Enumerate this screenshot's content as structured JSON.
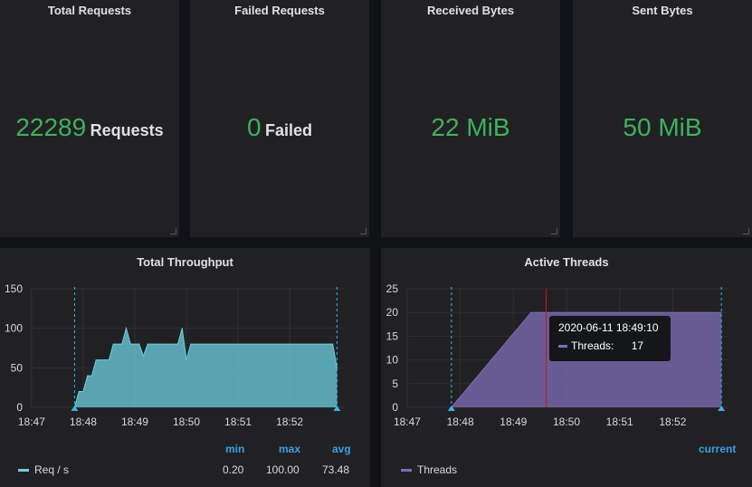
{
  "stats": [
    {
      "title": "Total Requests",
      "value": "22289",
      "unit": "Requests"
    },
    {
      "title": "Failed Requests",
      "value": "0",
      "unit": "Failed"
    },
    {
      "title": "Received Bytes",
      "value": "22 MiB",
      "unit": ""
    },
    {
      "title": "Sent Bytes",
      "value": "50 MiB",
      "unit": ""
    }
  ],
  "throughput": {
    "title": "Total Throughput",
    "legend": {
      "series": "Req / s",
      "min_label": "min",
      "max_label": "max",
      "avg_label": "avg",
      "min": "0.20",
      "max": "100.00",
      "avg": "73.48"
    },
    "color": "#6ed0e0"
  },
  "threads": {
    "title": "Active Threads",
    "legend": {
      "series": "Threads",
      "current_label": "current"
    },
    "tooltip": {
      "time": "2020-06-11 18:49:10",
      "label": "Threads:",
      "value": "17"
    },
    "color": "#806eb7"
  },
  "chart_data": [
    {
      "type": "area",
      "title": "Total Throughput",
      "x_ticks": [
        "18:47",
        "18:48",
        "18:49",
        "18:50",
        "18:51",
        "18:52"
      ],
      "y_ticks": [
        0,
        50,
        100,
        150
      ],
      "ylim": [
        0,
        150
      ],
      "series": [
        {
          "name": "Req / s",
          "x": [
            "18:47:50",
            "18:47:55",
            "18:48:00",
            "18:48:05",
            "18:48:10",
            "18:48:15",
            "18:48:20",
            "18:48:30",
            "18:48:35",
            "18:48:45",
            "18:48:50",
            "18:48:55",
            "18:49:05",
            "18:49:10",
            "18:49:15",
            "18:49:25",
            "18:49:35",
            "18:49:50",
            "18:49:55",
            "18:50:00",
            "18:50:05",
            "18:50:10",
            "18:51:00",
            "18:52:00",
            "18:52:50",
            "18:52:55"
          ],
          "y": [
            0,
            20,
            20,
            40,
            40,
            60,
            60,
            60,
            80,
            80,
            100,
            80,
            80,
            65,
            80,
            80,
            80,
            80,
            100,
            60,
            80,
            80,
            80,
            80,
            80,
            50
          ]
        }
      ]
    },
    {
      "type": "area",
      "title": "Active Threads",
      "x_ticks": [
        "18:47",
        "18:48",
        "18:49",
        "18:50",
        "18:51",
        "18:52"
      ],
      "y_ticks": [
        0,
        5,
        10,
        15,
        20,
        25
      ],
      "ylim": [
        0,
        25
      ],
      "series": [
        {
          "name": "Threads",
          "x": [
            "18:47:50",
            "18:49:20",
            "18:52:55"
          ],
          "y": [
            0,
            20,
            20
          ]
        }
      ]
    }
  ]
}
